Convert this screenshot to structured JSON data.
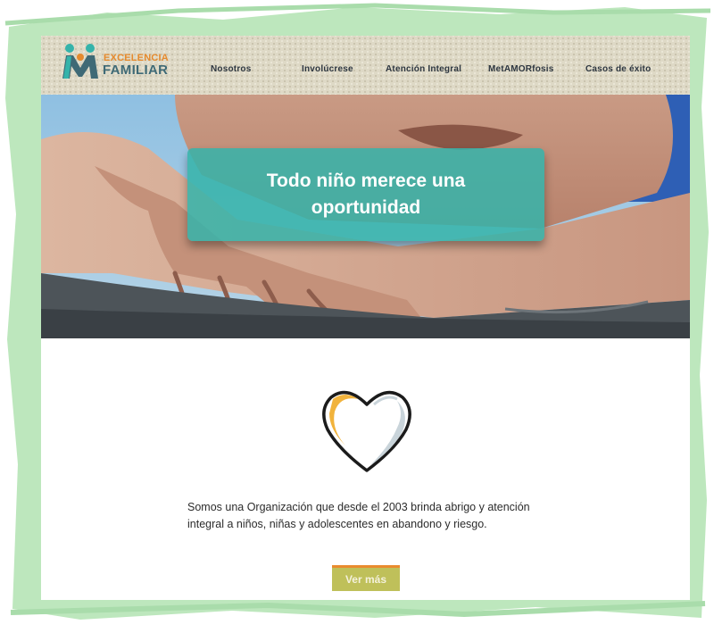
{
  "brand": {
    "name_top": "EXCELENCIA",
    "name_bottom": "FAMILIAR",
    "colors": {
      "orange": "#e58a2e",
      "teal": "#35b3aa",
      "slate": "#3f6a76"
    }
  },
  "nav": {
    "items": [
      {
        "label": "Nosotros"
      },
      {
        "label": "Involúcrese"
      },
      {
        "label": "Atención Integral"
      },
      {
        "label": "MetAMORfosis"
      },
      {
        "label": "Casos de éxito"
      }
    ]
  },
  "hero": {
    "title": "Todo niño merece una oportunidad",
    "image": "child-resting-on-arms-photo"
  },
  "intro": {
    "text": "Somos una Organización que desde el 2003 brinda abrigo y atención integral a niños, niñas y adolescentes en abandono y riesgo."
  },
  "cta": {
    "label": "Ver más"
  },
  "frame": {
    "color": "#bde7bd"
  }
}
